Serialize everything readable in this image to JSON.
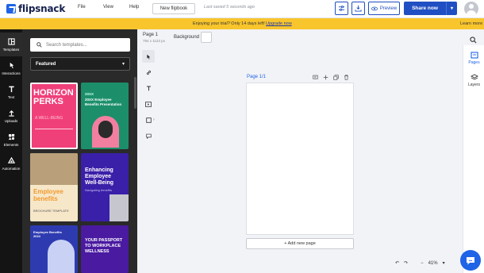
{
  "app": {
    "brand": "flipsnack"
  },
  "topbar": {
    "menu": [
      "File",
      "View",
      "Help"
    ],
    "document_title": "New flipbook",
    "save_status": "Last saved 5 seconds ago",
    "preview_label": "Preview",
    "share_label": "Share now"
  },
  "banner": {
    "message": "Enjoying your trial? Only 14 days left!",
    "upgrade_label": "Upgrade now",
    "learn_label": "Learn more"
  },
  "rail": {
    "items": [
      {
        "label": "Templates",
        "icon": "templates-icon"
      },
      {
        "label": "Interactions",
        "icon": "interactions-icon"
      },
      {
        "label": "Text",
        "icon": "text-icon"
      },
      {
        "label": "Uploads",
        "icon": "upload-icon"
      },
      {
        "label": "Elements",
        "icon": "elements-icon"
      },
      {
        "label": "Automation",
        "icon": "automation-icon"
      }
    ]
  },
  "panel": {
    "search_placeholder": "Search templates...",
    "filter_value": "Featured",
    "cards": [
      {
        "lines": [
          "HORIZON",
          "PERKS"
        ],
        "sub": "A WELL-BEING",
        "bg": "#f0407a"
      },
      {
        "lines": [
          "20XX Employee",
          "Benefits Presentation"
        ],
        "sub": "",
        "bg": "#1c8f6a"
      },
      {
        "lines": [
          "Employee",
          "benefits"
        ],
        "sub": "BROCHURE TEMPLATE",
        "bg": "#f6e7c9"
      },
      {
        "lines": [
          "Enhancing",
          "Employee",
          "Well-Being"
        ],
        "sub": "Navigating benefits",
        "bg": "#3a1fa8"
      },
      {
        "lines": [
          "Employee Benefits",
          "2024"
        ],
        "sub": "",
        "bg": "#2e3bb0"
      },
      {
        "lines": [
          "YOUR PASSPORT",
          "TO WORKPLACE",
          "WELLNESS"
        ],
        "sub": "",
        "bg": "#4a1aa0"
      }
    ]
  },
  "page": {
    "label": "Page 1",
    "size": "794 x 1123 px",
    "background_label": "Background",
    "title": "Page 1/1",
    "add_page_label": "+ Add new page"
  },
  "right_rail": {
    "pages_label": "Pages",
    "layers_label": "Layers"
  },
  "zoom": {
    "value": "41%"
  },
  "colors": {
    "accent": "#1f4fc2",
    "banner": "#f8c52c",
    "panel": "#2a2a2a",
    "rail": "#141414"
  }
}
